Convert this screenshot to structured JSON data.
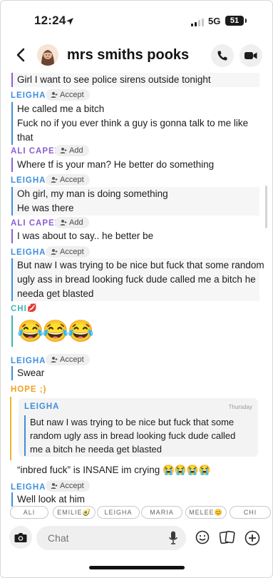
{
  "status_bar": {
    "time": "12:24",
    "network": "5G",
    "battery": "51"
  },
  "header": {
    "title": "mrs smiths pooks"
  },
  "colors": {
    "leigha": "#3e8fdb",
    "ali": "#8b5fd6",
    "chi": "#3fb5ae",
    "hope": "#f0a020"
  },
  "messages": {
    "m0": {
      "lines": [
        "Girl I want to see police sirens outside tonight"
      ]
    },
    "s1": {
      "name": "LEIGHA",
      "action": "Accept"
    },
    "m1": {
      "lines": [
        "He called me a bitch",
        "Fuck no if you ever think a guy is gonna talk to me like",
        "that"
      ]
    },
    "s2": {
      "name": "ALI CAPEL",
      "action": "Add"
    },
    "m2": {
      "lines": [
        "Where tf is your man? He better do something"
      ]
    },
    "s3": {
      "name": "LEIGHA",
      "action": "Accept"
    },
    "m3": {
      "lines": [
        "Oh girl, my man is doing something",
        "He was there"
      ]
    },
    "s4": {
      "name": "ALI CAPEL",
      "action": "Add"
    },
    "m4": {
      "lines": [
        "I was about to say.. he better be"
      ]
    },
    "s5": {
      "name": "LEIGHA",
      "action": "Accept"
    },
    "m5": {
      "lines": [
        "But naw I was trying to be nice but fuck that some random",
        "ugly ass in bread looking fuck dude called me a bitch he",
        "needa get blasted"
      ]
    },
    "s6": {
      "name": "CHI",
      "emoji": "💋"
    },
    "m6": {
      "emoji": "😂😂😂"
    },
    "s7": {
      "name": "LEIGHA",
      "action": "Accept"
    },
    "m7": {
      "lines": [
        "Swear"
      ]
    },
    "s8": {
      "name": "HOPE ;)"
    },
    "reply": {
      "quoted_name": "LEIGHA",
      "quoted_time": "Thursday",
      "quoted_lines": [
        "But naw I was trying to be nice but fuck that some",
        "random ugly ass in bread looking fuck dude called",
        "me a bitch he needa get blasted"
      ],
      "text": "“inbred fuck” is INSANE im crying 😭😭😭😭"
    },
    "s9": {
      "name": "LEIGHA",
      "action": "Accept"
    },
    "m9": {
      "lines": [
        "Well look at him"
      ]
    }
  },
  "mention_chips": [
    "ALI",
    "EMILIE🥑",
    "LEIGHA",
    "MARIA",
    "MELEE😊",
    "CHI"
  ],
  "composer": {
    "placeholder": "Chat"
  }
}
